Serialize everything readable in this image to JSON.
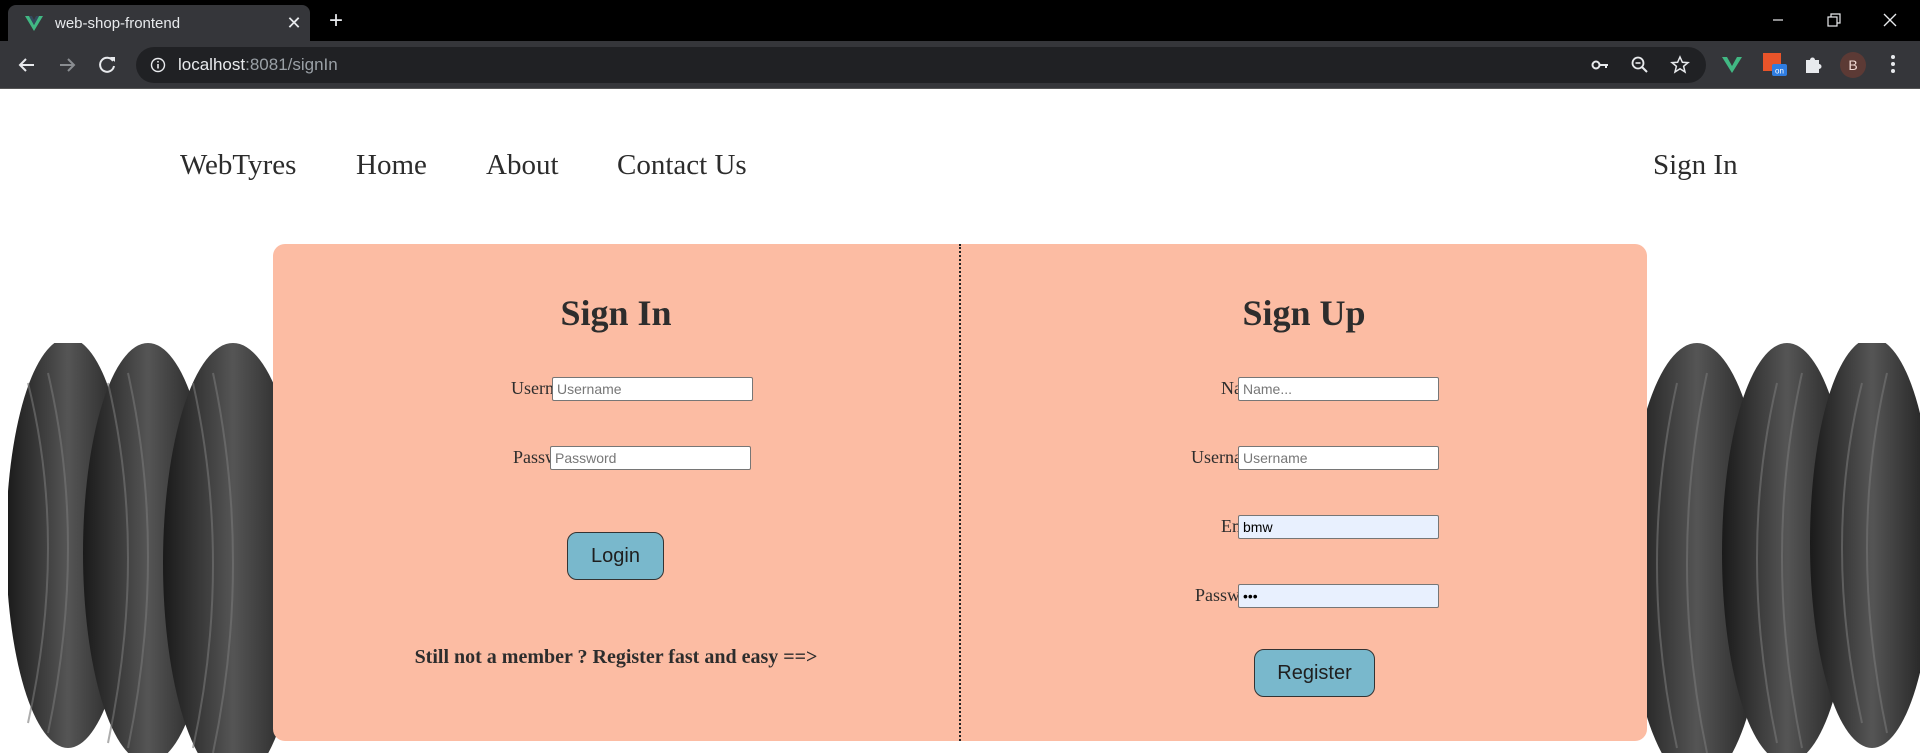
{
  "browser": {
    "tab": {
      "title": "web-shop-frontend",
      "favicon": "vue-logo-icon"
    },
    "url": {
      "host": "localhost",
      "rest": ":8081/signIn"
    },
    "profile_initial": "B"
  },
  "site": {
    "brand": "WebTyres",
    "nav": {
      "home": "Home",
      "about": "About",
      "contact": "Contact Us",
      "sign_in": "Sign In"
    }
  },
  "sign_in": {
    "title": "Sign In",
    "username": {
      "label": "Username",
      "placeholder": "Username",
      "value": ""
    },
    "password": {
      "label": "Password",
      "placeholder": "Password",
      "value": ""
    },
    "button": "Login",
    "promo": "Still not a member ? Register fast and easy ==>"
  },
  "sign_up": {
    "title": "Sign Up",
    "name": {
      "label": "Name",
      "placeholder": "Name...",
      "value": ""
    },
    "username": {
      "label": "Username",
      "placeholder": "Username",
      "value": ""
    },
    "email": {
      "label": "Email",
      "placeholder": "",
      "value": "bmw"
    },
    "password": {
      "label": "Password",
      "placeholder": "",
      "value": "•••"
    },
    "button": "Register"
  },
  "colors": {
    "card": "#fcbca3",
    "button": "#79b8cc",
    "chrome_dark": "#35363a"
  }
}
